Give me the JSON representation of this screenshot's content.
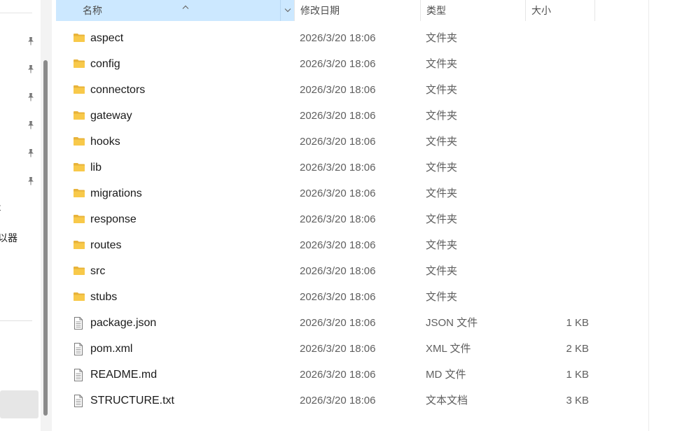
{
  "nav": {
    "fragment_1": "t",
    "fragment_2": "以器"
  },
  "columns": {
    "name": "名称",
    "date": "修改日期",
    "type": "类型",
    "size": "大小"
  },
  "files": [
    {
      "name": "aspect",
      "date": "2026/3/20 18:06",
      "type": "文件夹",
      "size": "",
      "kind": "folder"
    },
    {
      "name": "config",
      "date": "2026/3/20 18:06",
      "type": "文件夹",
      "size": "",
      "kind": "folder"
    },
    {
      "name": "connectors",
      "date": "2026/3/20 18:06",
      "type": "文件夹",
      "size": "",
      "kind": "folder"
    },
    {
      "name": "gateway",
      "date": "2026/3/20 18:06",
      "type": "文件夹",
      "size": "",
      "kind": "folder"
    },
    {
      "name": "hooks",
      "date": "2026/3/20 18:06",
      "type": "文件夹",
      "size": "",
      "kind": "folder"
    },
    {
      "name": "lib",
      "date": "2026/3/20 18:06",
      "type": "文件夹",
      "size": "",
      "kind": "folder"
    },
    {
      "name": "migrations",
      "date": "2026/3/20 18:06",
      "type": "文件夹",
      "size": "",
      "kind": "folder"
    },
    {
      "name": "response",
      "date": "2026/3/20 18:06",
      "type": "文件夹",
      "size": "",
      "kind": "folder"
    },
    {
      "name": "routes",
      "date": "2026/3/20 18:06",
      "type": "文件夹",
      "size": "",
      "kind": "folder"
    },
    {
      "name": "src",
      "date": "2026/3/20 18:06",
      "type": "文件夹",
      "size": "",
      "kind": "folder"
    },
    {
      "name": "stubs",
      "date": "2026/3/20 18:06",
      "type": "文件夹",
      "size": "",
      "kind": "folder"
    },
    {
      "name": "package.json",
      "date": "2026/3/20 18:06",
      "type": "JSON 文件",
      "size": "1 KB",
      "kind": "file"
    },
    {
      "name": "pom.xml",
      "date": "2026/3/20 18:06",
      "type": "XML 文件",
      "size": "2 KB",
      "kind": "file"
    },
    {
      "name": "README.md",
      "date": "2026/3/20 18:06",
      "type": "MD 文件",
      "size": "1 KB",
      "kind": "file"
    },
    {
      "name": "STRUCTURE.txt",
      "date": "2026/3/20 18:06",
      "type": "文本文档",
      "size": "3 KB",
      "kind": "file"
    }
  ],
  "icons": {
    "folder": "folder-icon",
    "file": "document-icon",
    "pin": "pin-icon"
  },
  "colors": {
    "header_selected": "#cce8ff",
    "folder": "#f8c94a"
  }
}
